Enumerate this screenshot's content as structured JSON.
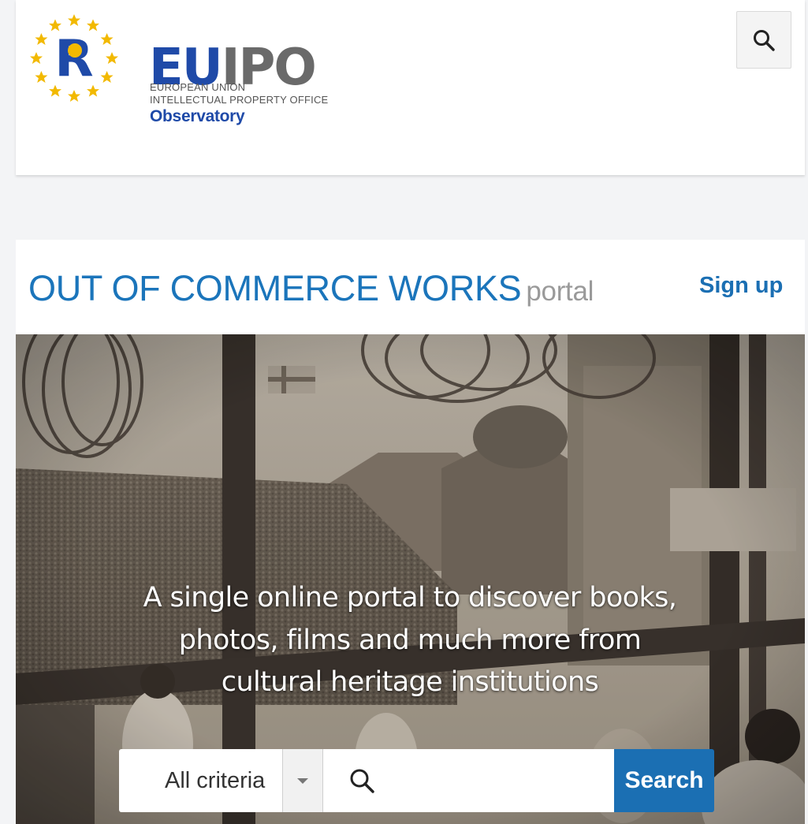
{
  "header": {
    "logo": {
      "mark_eu": "EU",
      "mark_ipo": "IPO",
      "line1": "EUROPEAN UNION",
      "line2": "INTELLECTUAL PROPERTY OFFICE",
      "subtitle": "Observatory",
      "emblem_letter": "R"
    },
    "search_toggle_icon": "search-icon"
  },
  "title_bar": {
    "title": "OUT OF COMMERCE WORKS",
    "suffix": "portal",
    "signup_label": "Sign up"
  },
  "hero": {
    "tagline": "A single online portal to discover books, photos, films and much more from cultural heritage institutions"
  },
  "search": {
    "criteria_value": "All criteria",
    "query_value": "",
    "query_placeholder": "",
    "button_label": "Search"
  },
  "colors": {
    "brand_blue": "#1f4aa8",
    "title_blue": "#1b75bb",
    "button_blue": "#1b6fb3",
    "star_gold": "#f2b900"
  }
}
